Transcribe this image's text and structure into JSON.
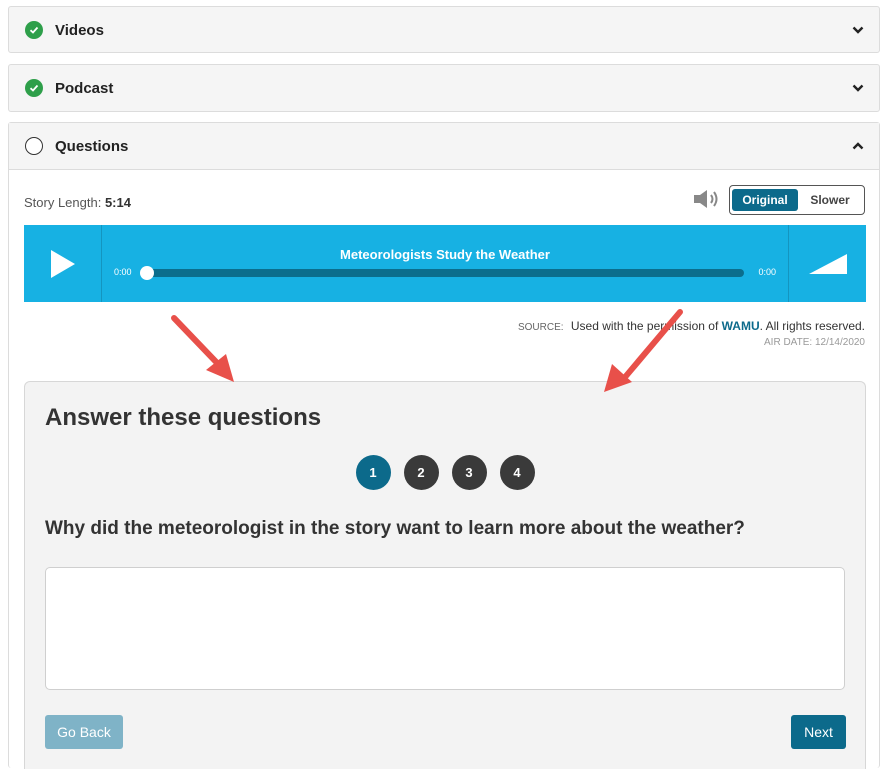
{
  "sections": {
    "videos": {
      "title": "Videos",
      "status_icon": "check-circle-icon",
      "chevron": "chevron-down-icon"
    },
    "podcast": {
      "title": "Podcast",
      "status_icon": "check-circle-icon",
      "chevron": "chevron-down-icon"
    },
    "questions": {
      "title": "Questions",
      "status_icon": "empty-circle-icon",
      "chevron": "chevron-up-icon"
    }
  },
  "story": {
    "length_label": "Story Length:",
    "length_value": "5:14"
  },
  "speed_toggle": {
    "original": "Original",
    "slower": "Slower",
    "selected": "Original"
  },
  "player": {
    "title": "Meteorologists Study the Weather",
    "current_time": "0:00",
    "total_time": "0:00",
    "progress": 0
  },
  "source": {
    "label": "SOURCE:",
    "text_before": "Used with the permissio",
    "text_hidden": "n of ",
    "org": "WAMU",
    "text_after": ". All rights reserved.",
    "air_date": "AIR DATE: 12/14/2020"
  },
  "quiz": {
    "heading": "Answer these questions",
    "steps": [
      "1",
      "2",
      "3",
      "4"
    ],
    "active_step": 1,
    "question": "Why did the meteorologist in the story want to learn more about the weather?",
    "answer": "",
    "back_label": "Go Back",
    "next_label": "Next"
  },
  "colors": {
    "accent": "#0c6a8b",
    "player_bg": "#17b1e3",
    "check_green": "#2e9f4a",
    "annotation_arrow": "#e8504a"
  }
}
